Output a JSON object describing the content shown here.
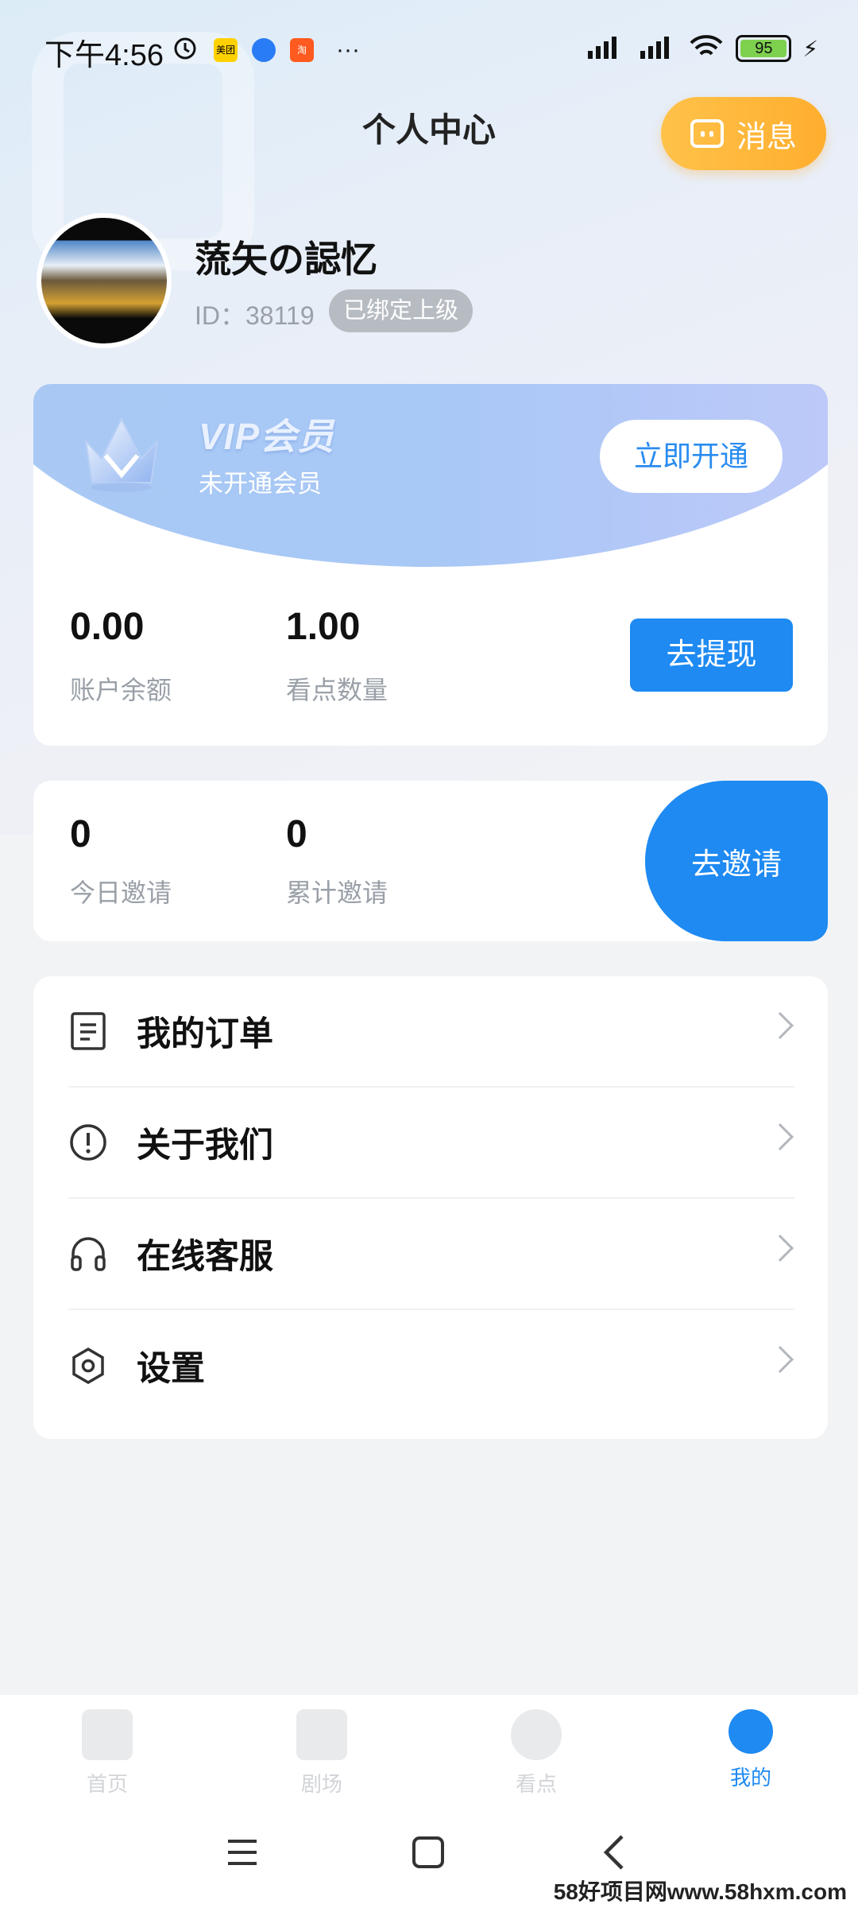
{
  "status_bar": {
    "time": "下午4:56",
    "battery": "95",
    "mini_icon_1": "美团",
    "mini_icon_3": "淘"
  },
  "header": {
    "title": "个人中心",
    "message_label": "消息"
  },
  "profile": {
    "username": "蓅矢の誋忆",
    "id_text": "ID：38119",
    "bound_badge": "已绑定上级"
  },
  "vip": {
    "title": "VIP会员",
    "subtitle": "未开通会员",
    "open_label": "立即开通"
  },
  "wallet": {
    "balance_value": "0.00",
    "balance_label": "账户余额",
    "points_value": "1.00",
    "points_label": "看点数量",
    "withdraw_label": "去提现"
  },
  "invite": {
    "today_value": "0",
    "today_label": "今日邀请",
    "total_value": "0",
    "total_label": "累计邀请",
    "invite_label": "去邀请"
  },
  "menu": {
    "items": [
      {
        "label": "我的订单",
        "icon": "order-list-icon"
      },
      {
        "label": "关于我们",
        "icon": "info-circle-icon"
      },
      {
        "label": "在线客服",
        "icon": "headset-icon"
      },
      {
        "label": "设置",
        "icon": "settings-hexagon-icon"
      }
    ]
  },
  "bottom_nav": {
    "items": [
      {
        "label": "首页",
        "icon": "home-icon"
      },
      {
        "label": "剧场",
        "icon": "play-icon"
      },
      {
        "label": "看点",
        "icon": "money-bag-icon"
      },
      {
        "label": "我的",
        "icon": "user-icon"
      }
    ],
    "active": "我的"
  },
  "colors": {
    "primary": "#1e8af2",
    "message_button": "#ffb233",
    "badge": "#b7bcc3"
  },
  "watermark": "58好项目网www.58hxm.com"
}
